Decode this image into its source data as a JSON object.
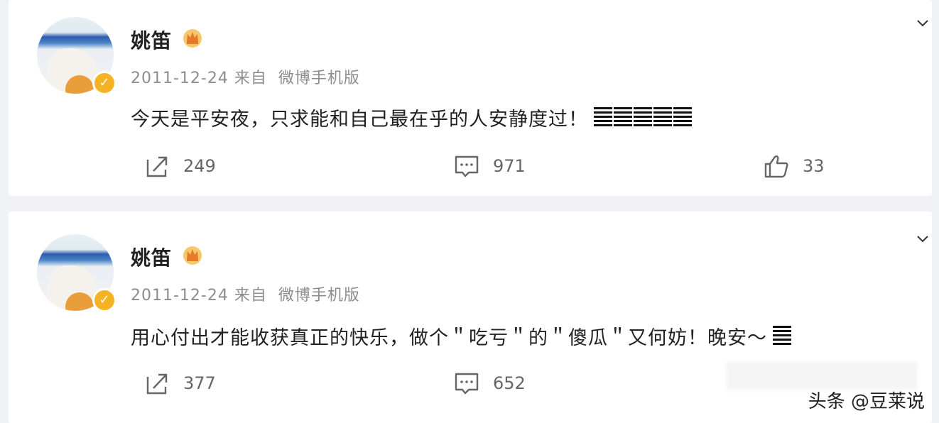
{
  "posts": [
    {
      "author": "姚笛",
      "date": "2011-12-24",
      "from_prefix": "来自",
      "source": "微博手机版",
      "content": "今天是平安夜，只求能和自己最在乎的人安静度过！",
      "emoji_count": 5,
      "repost_count": "249",
      "comment_count": "971",
      "like_count": "33"
    },
    {
      "author": "姚笛",
      "date": "2011-12-24",
      "from_prefix": "来自",
      "source": "微博手机版",
      "content": "用心付出才能收获真正的快乐，做个＂吃亏＂的＂傻瓜＂又何妨！晚安～",
      "emoji_count": 1,
      "repost_count": "377",
      "comment_count": "652"
    }
  ],
  "watermark": "头条 @豆莱说",
  "icons": {
    "repost": "share-icon",
    "comment": "comment-icon",
    "like": "thumbs-up-icon",
    "more": "chevron-down-icon",
    "vip": "crown-icon",
    "verified": "verified-badge-icon"
  },
  "colors": {
    "background": "#f1f2f5",
    "card": "#ffffff",
    "verified": "#f5b323",
    "meta_text": "#8c8c8c"
  }
}
